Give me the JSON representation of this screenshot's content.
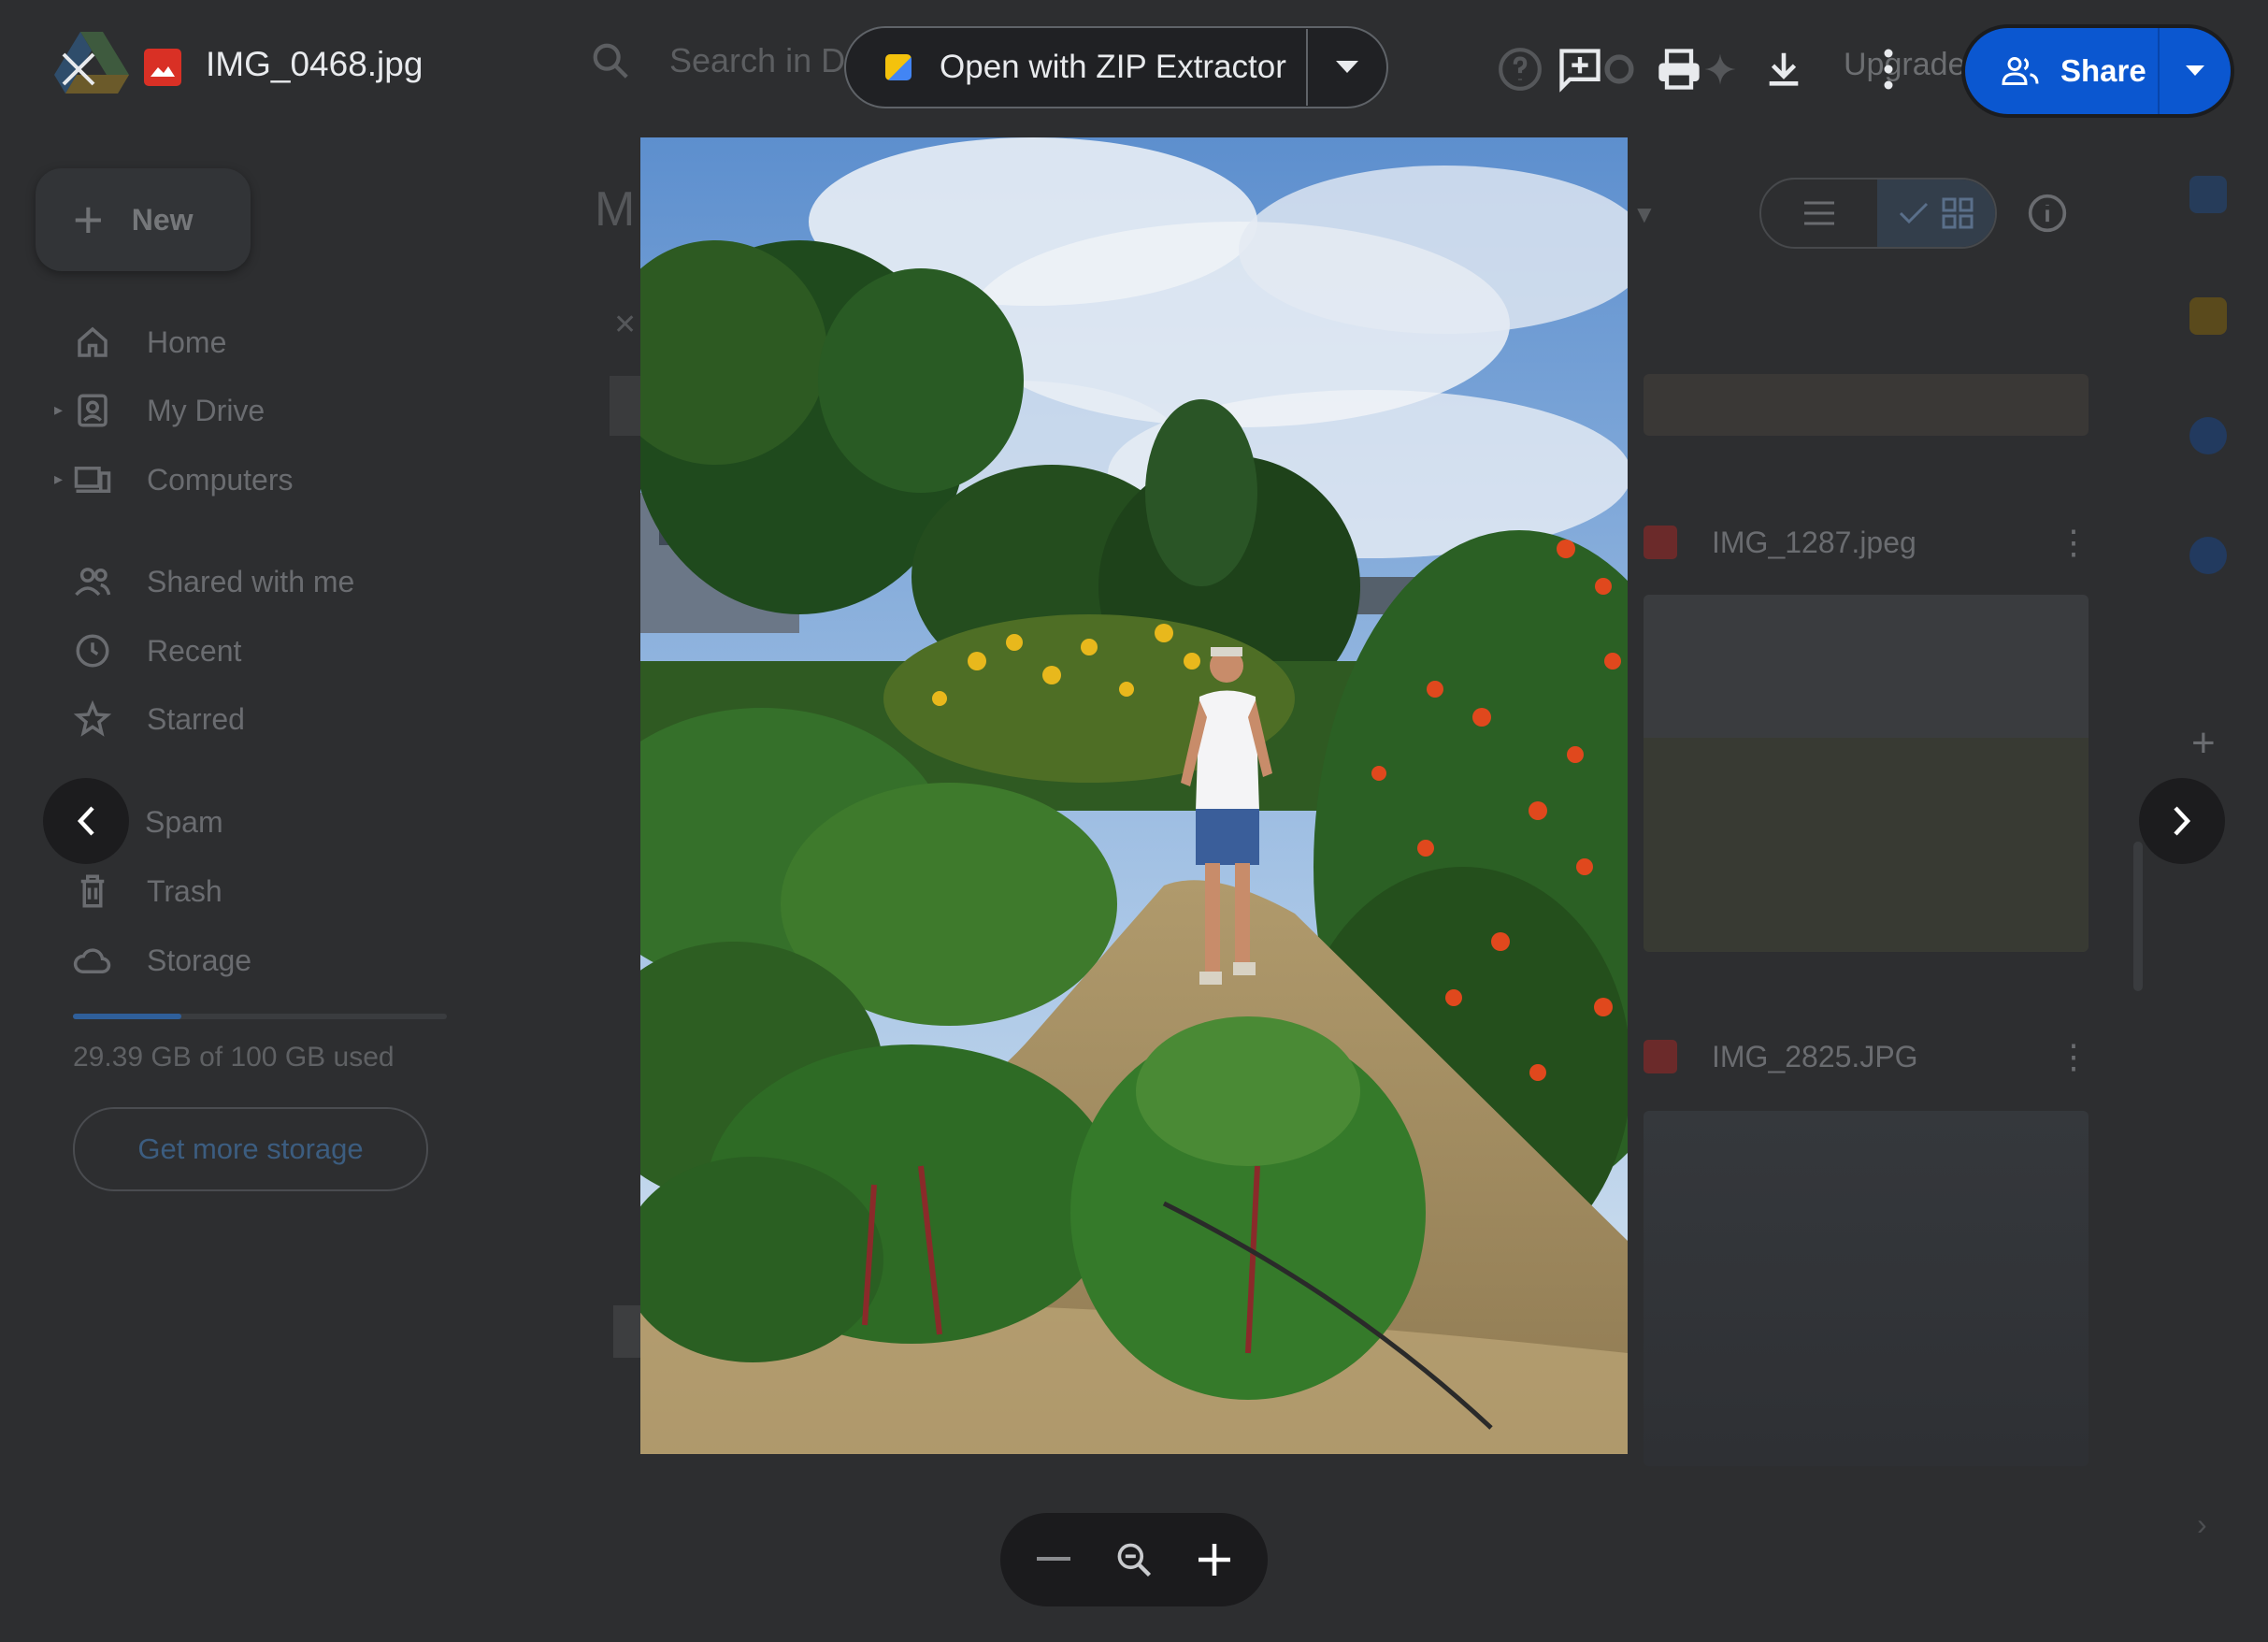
{
  "viewer": {
    "file_name": "IMG_0468.jpg",
    "open_with_label": "Open with ZIP Extractor",
    "share_label": "Share"
  },
  "background": {
    "app_title_fragment": "M",
    "search_placeholder": "Search in D",
    "upgrade_label": "Upgrade",
    "new_label": "New",
    "nav": [
      {
        "label": "Home",
        "icon": "home-icon"
      },
      {
        "label": "My Drive",
        "icon": "my-drive-icon"
      },
      {
        "label": "Computers",
        "icon": "computers-icon"
      },
      {
        "label": "Shared with me",
        "icon": "shared-icon"
      },
      {
        "label": "Recent",
        "icon": "clock-icon"
      },
      {
        "label": "Starred",
        "icon": "star-icon"
      },
      {
        "label": "Spam",
        "icon": "spam-icon"
      },
      {
        "label": "Trash",
        "icon": "trash-icon"
      },
      {
        "label": "Storage",
        "icon": "cloud-icon"
      }
    ],
    "storage_text": "29.39 GB of 100 GB used",
    "storage_fraction": 0.29,
    "get_storage_label": "Get more storage",
    "files": [
      {
        "name": "IMG_1287.jpeg"
      },
      {
        "name": "IMG_2825.JPG"
      }
    ]
  },
  "colors": {
    "accent": "#0b57d0",
    "viewer_bg": "#2d2e30",
    "file_icon": "#d93025"
  }
}
